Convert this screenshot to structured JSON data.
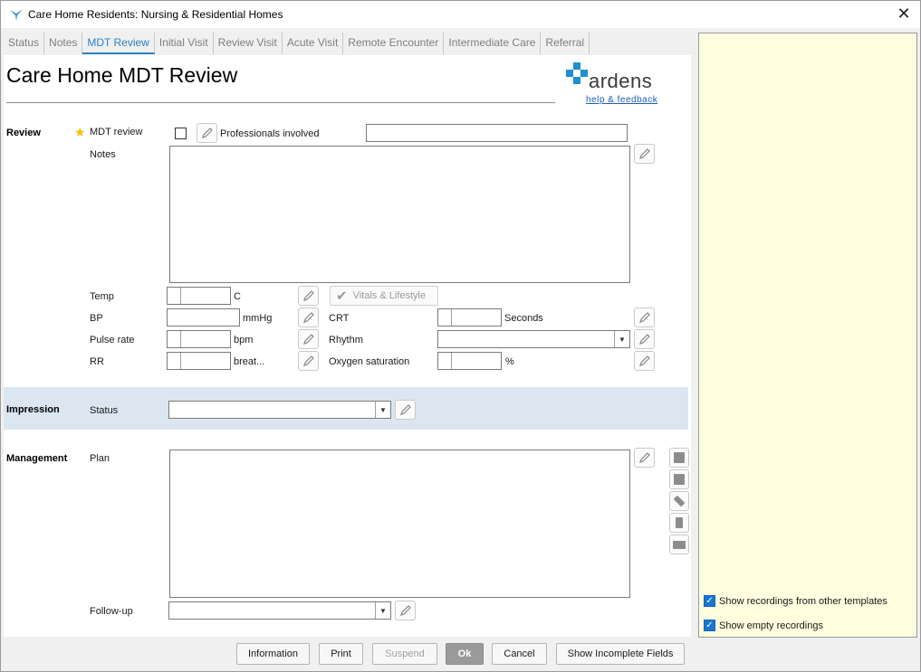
{
  "window": {
    "title": "Care Home Residents: Nursing & Residential Homes"
  },
  "tabs": [
    {
      "label": "Status"
    },
    {
      "label": "Notes"
    },
    {
      "label": "MDT Review"
    },
    {
      "label": "Initial Visit"
    },
    {
      "label": "Review Visit"
    },
    {
      "label": "Acute Visit"
    },
    {
      "label": "Remote Encounter"
    },
    {
      "label": "Intermediate Care"
    },
    {
      "label": "Referral"
    }
  ],
  "active_tab": "MDT Review",
  "form": {
    "title": "Care Home MDT Review",
    "logo_text": "ardens",
    "help_link": "help & feedback"
  },
  "review": {
    "section": "Review",
    "mdt_review_label": "MDT review",
    "mdt_review_checked": false,
    "professionals_label": "Professionals involved",
    "professionals_value": "",
    "notes_label": "Notes",
    "notes_value": ""
  },
  "vitals": {
    "temp_label": "Temp",
    "temp_unit": "C",
    "temp_value": "",
    "bp_label": "BP",
    "bp_unit": "mmHg",
    "bp_value": "",
    "pulse_label": "Pulse rate",
    "pulse_unit": "bpm",
    "pulse_value": "",
    "rr_label": "RR",
    "rr_unit": "breat...",
    "rr_value": "",
    "vitals_button": "Vitals & Lifestyle",
    "crt_label": "CRT",
    "crt_unit": "Seconds",
    "crt_value": "",
    "rhythm_label": "Rhythm",
    "rhythm_value": "",
    "o2_label": "Oxygen saturation",
    "o2_unit": "%",
    "o2_value": ""
  },
  "impression": {
    "section": "Impression",
    "status_label": "Status",
    "status_value": ""
  },
  "management": {
    "section": "Management",
    "plan_label": "Plan",
    "plan_value": "",
    "followup_label": "Follow-up",
    "followup_value": ""
  },
  "side_tools": [
    {
      "icon": "calendar-icon"
    },
    {
      "icon": "document-icon"
    },
    {
      "icon": "bandage-icon"
    },
    {
      "icon": "medication-bottle-icon"
    },
    {
      "icon": "printer-icon"
    }
  ],
  "right_panel": {
    "show_other_templates_label": "Show recordings from other templates",
    "show_other_templates_checked": true,
    "show_empty_label": "Show empty recordings",
    "show_empty_checked": true
  },
  "footer": {
    "information": "Information",
    "print": "Print",
    "suspend": "Suspend",
    "ok": "Ok",
    "cancel": "Cancel",
    "show_incomplete": "Show Incomplete Fields"
  },
  "colors": {
    "accent": "#2b83c6",
    "impression_band": "#dce6f1",
    "right_panel_bg": "#ffffe0",
    "logo_blue": "#1e8fd0"
  }
}
